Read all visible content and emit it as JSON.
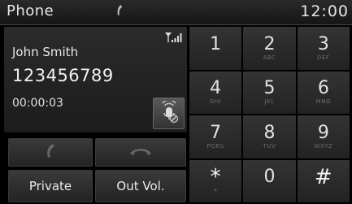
{
  "header": {
    "title": "Phone",
    "clock": "12:00"
  },
  "call": {
    "name": "John Smith",
    "number": "123456789",
    "timer": "00:00:03"
  },
  "buttons": {
    "private": "Private",
    "out_vol": "Out Vol."
  },
  "keypad": [
    {
      "digit": "1",
      "letters": ""
    },
    {
      "digit": "2",
      "letters": "ABC"
    },
    {
      "digit": "3",
      "letters": "DEF"
    },
    {
      "digit": "4",
      "letters": "GHI"
    },
    {
      "digit": "5",
      "letters": "JKL"
    },
    {
      "digit": "6",
      "letters": "MNO"
    },
    {
      "digit": "7",
      "letters": "PQRS"
    },
    {
      "digit": "8",
      "letters": "TUV"
    },
    {
      "digit": "9",
      "letters": "WXYZ"
    },
    {
      "digit": "*",
      "letters": "+"
    },
    {
      "digit": "0",
      "letters": ""
    },
    {
      "digit": "#",
      "letters": ""
    }
  ],
  "icons": {
    "call_status": "phone-handset-icon",
    "signal": "signal-strength-icon",
    "mute": "microphone-mute-icon",
    "accept": "phone-accept-icon",
    "end": "phone-end-icon"
  }
}
